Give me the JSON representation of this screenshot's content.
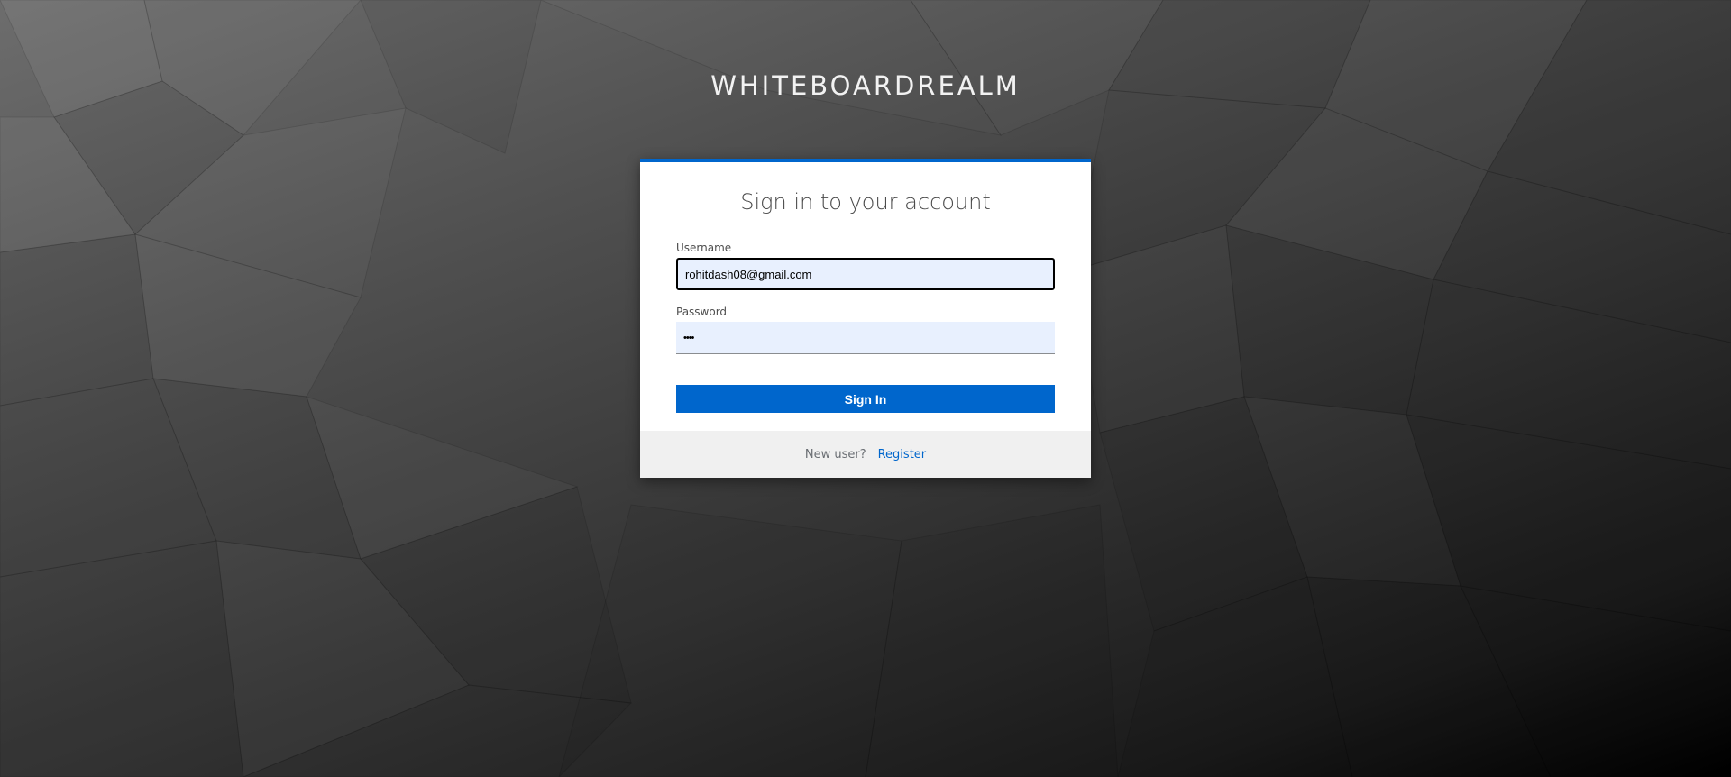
{
  "realm": {
    "title": "WHITEBOARDREALM"
  },
  "login": {
    "heading": "Sign in to your account",
    "username_label": "Username",
    "username_value": "rohitdash08@gmail.com",
    "password_label": "Password",
    "password_value": "••••",
    "submit_label": "Sign In",
    "footer_text": "New user?",
    "register_label": "Register"
  },
  "colors": {
    "accent": "#0066cc",
    "input_autofill_bg": "#e8f0fe",
    "footer_bg": "#f0f0f0"
  }
}
